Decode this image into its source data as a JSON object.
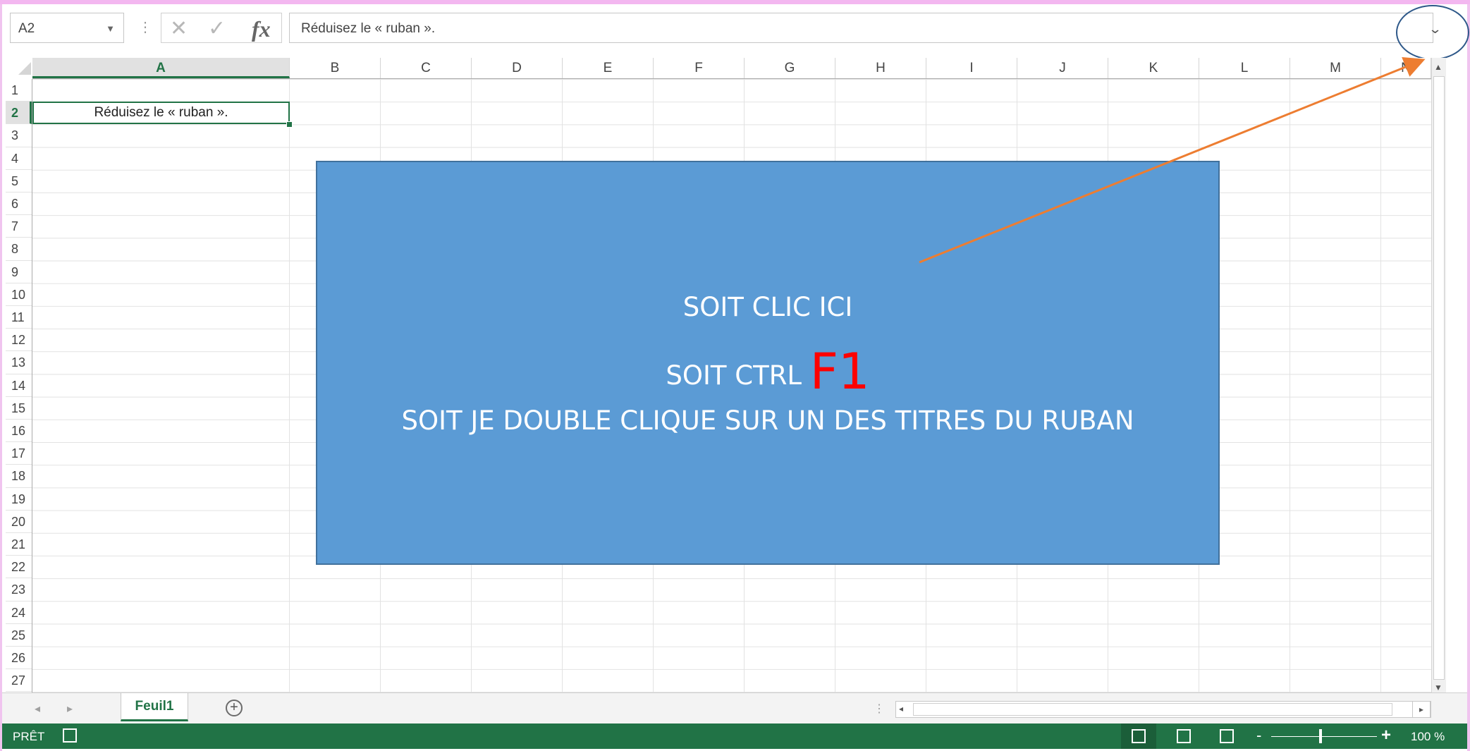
{
  "formula_bar": {
    "name_box": "A2",
    "formula": "Réduisez le « ruban »."
  },
  "grid": {
    "columns": [
      "A",
      "B",
      "C",
      "D",
      "E",
      "F",
      "G",
      "H",
      "I",
      "J",
      "K",
      "L",
      "M",
      "N"
    ],
    "rows": [
      "1",
      "2",
      "3",
      "4",
      "5",
      "6",
      "7",
      "8",
      "9",
      "10",
      "11",
      "12",
      "13",
      "14",
      "15",
      "16",
      "17",
      "18",
      "19",
      "20",
      "21",
      "22",
      "23",
      "24",
      "25",
      "26",
      "27"
    ],
    "selected_column": "A",
    "selected_row": "2",
    "cell_a2": "Réduisez le « ruban »."
  },
  "overlay": {
    "line1": "SOIT CLIC ICI",
    "line2_prefix": "SOIT CTRL",
    "line2_key": "F1",
    "line3": "SOIT  JE DOUBLE CLIQUE SUR UN DES TITRES DU RUBAN",
    "fill_color": "#5b9bd5",
    "key_color": "#ff0000",
    "arrow_color": "#ed7d31"
  },
  "sheets": {
    "active": "Feuil1",
    "add_icon": "plus-circle-icon"
  },
  "status_bar": {
    "ready": "PRÊT",
    "zoom": "100 %",
    "accent": "#217346"
  },
  "icons": {
    "cancel": "✕",
    "confirm": "✓",
    "fx": "fx",
    "collapse_ribbon": "chevron-down-icon"
  }
}
